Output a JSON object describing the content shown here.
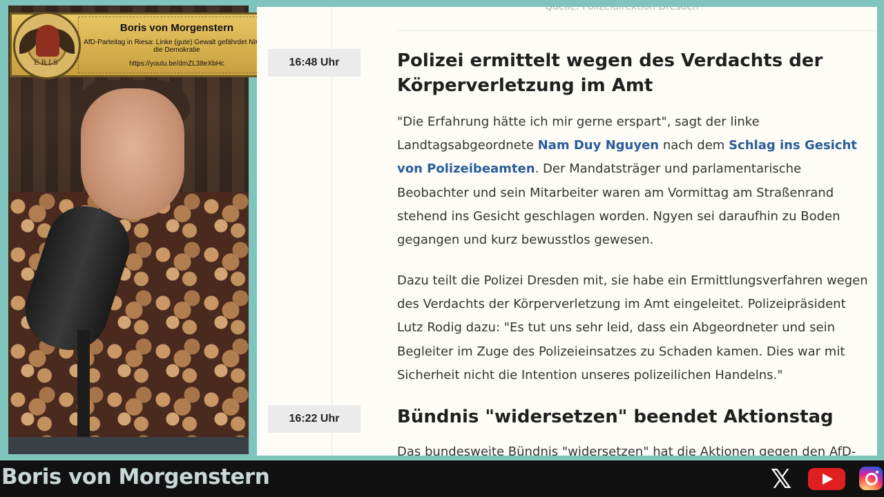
{
  "overlay": {
    "name": "Boris von Morgenstern",
    "video_title": "AfD-Parteitag in Riesa: Linke (gute) Gewalt gefährdet NICHT die Demokratie",
    "url": "https://youtu.be/dmZL38eXbHc",
    "logo_text": "ERIS"
  },
  "article": {
    "source_line": "Quelle: Polizeidirektion Dresden",
    "entries": [
      {
        "time": "16:48 Uhr",
        "headline": "Polizei ermittelt wegen des Verdachts der Körperverletzung im Amt",
        "p1_a": "\"Die Erfahrung hätte ich mir gerne erspart\", sagt der linke Landtagsabgeordnete ",
        "p1_link1": "Nam Duy Nguyen",
        "p1_b": " nach dem ",
        "p1_link2": "Schlag ins Gesicht von Polizeibeamten",
        "p1_c": ". Der Mandatsträger und parlamentarische Beobachter und sein Mitarbeiter waren am Vormittag am Straßenrand stehend ins Gesicht geschlagen worden. Ngyen sei daraufhin zu Boden gegangen und kurz bewusstlos gewesen.",
        "p2": "Dazu teilt die Polizei Dresden mit, sie habe ein Ermittlungsverfahren wegen des Verdachts der Körperverletzung im Amt eingeleitet. Polizeipräsident Lutz Rodig dazu: \"Es tut uns sehr leid, dass ein Abgeordneter und sein Begleiter im Zuge des Polizeieinsatzes zu Schaden kamen. Dies war mit Sicherheit nicht die Intention unseres polizeilichen Handelns.\""
      },
      {
        "time": "16:22 Uhr",
        "headline": "Bündnis \"widersetzen\" beendet Aktionstag",
        "p1": "Das bundesweite Bündnis \"widersetzen\" hat die Aktionen gegen den AfD-"
      }
    ]
  },
  "footer": {
    "channel_name": "Boris von Morgenstern",
    "icons": [
      "x-icon",
      "youtube-icon",
      "instagram-icon"
    ]
  }
}
